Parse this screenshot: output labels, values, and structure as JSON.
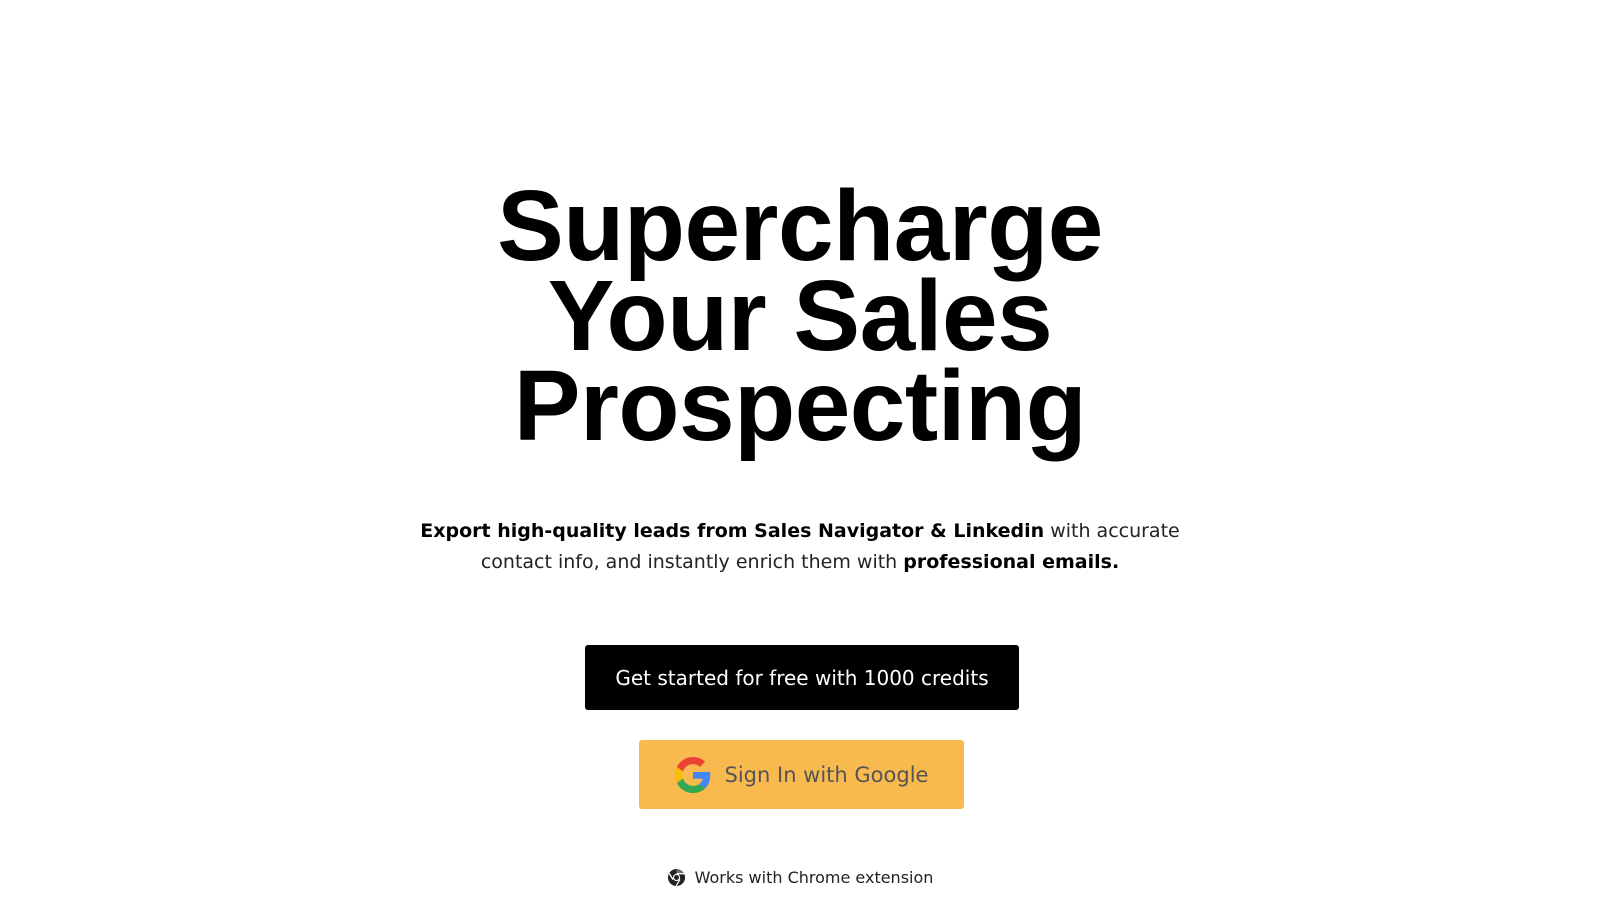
{
  "hero": {
    "title_lines": [
      "Supercharge",
      "Your Sales",
      "Prospecting"
    ]
  },
  "subtitle": {
    "bold_lead": "Export high-quality leads from Sales Navigator & Linkedin",
    "middle": " with accurate contact info, and instantly enrich them with ",
    "bold_end": "professional emails."
  },
  "cta": {
    "label": "Get started for free with 1000 credits",
    "background": "#000000"
  },
  "google_signin": {
    "label": "Sign In with Google",
    "icon": "google-g-icon",
    "background": "#f8b94f"
  },
  "footnote": {
    "icon": "chrome-icon",
    "text": "Works with Chrome extension"
  }
}
